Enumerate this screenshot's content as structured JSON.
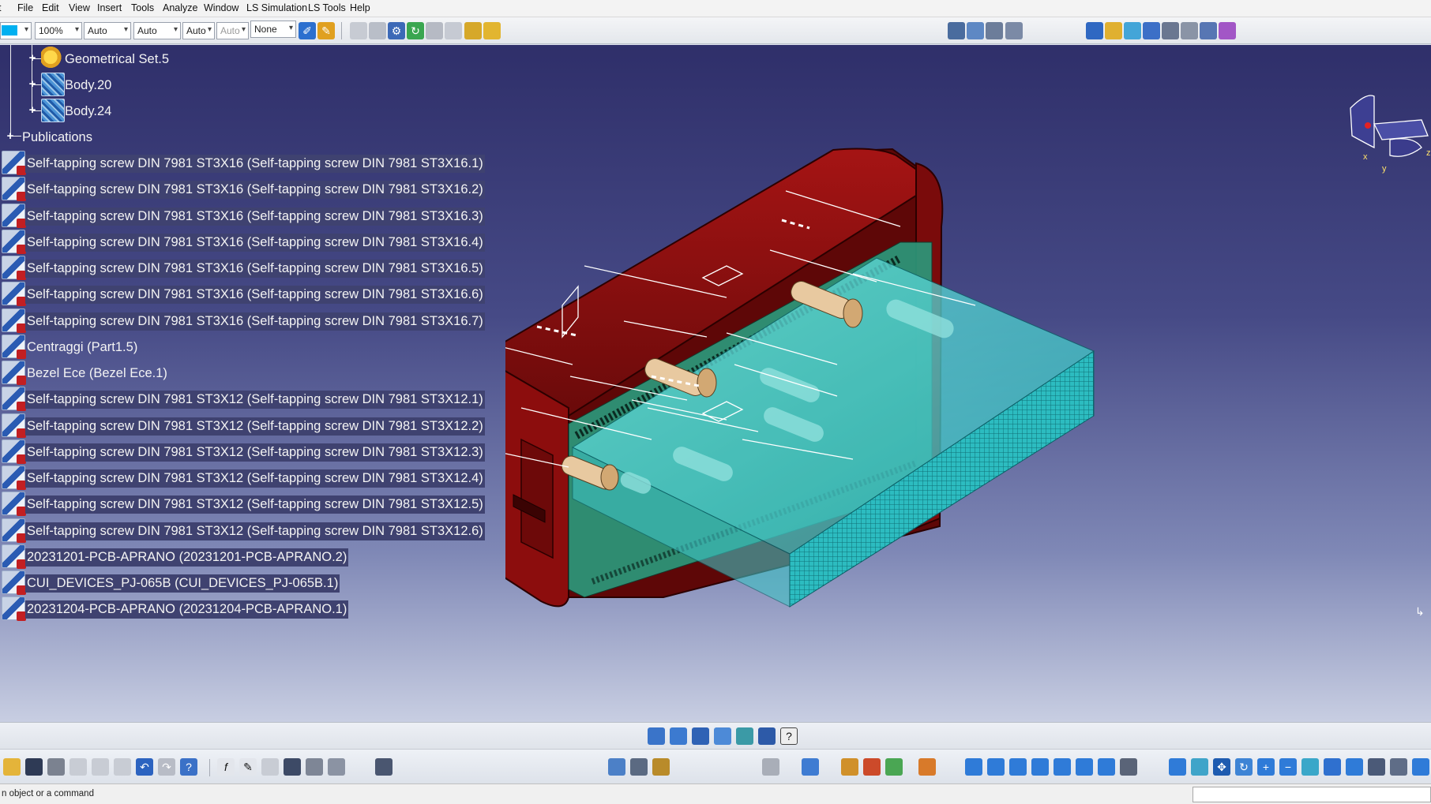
{
  "menu": {
    "items": [
      {
        "label": "File",
        "key": "F"
      },
      {
        "label": "Edit",
        "key": "E"
      },
      {
        "label": "View",
        "key": "V"
      },
      {
        "label": "Insert",
        "key": "I"
      },
      {
        "label": "Tools",
        "key": "T"
      },
      {
        "label": "Analyze",
        "key": "A"
      },
      {
        "label": "Window",
        "key": "W"
      },
      {
        "label": "LS Simulation",
        "key": ""
      },
      {
        "label": "LS Tools",
        "key": ""
      },
      {
        "label": "Help",
        "key": "H"
      }
    ]
  },
  "toolbar": {
    "zoom_value": "100%",
    "combo_auto_1": "Auto",
    "combo_auto_2": "Auto",
    "combo_auto_3": "Auto",
    "combo_auto_4": "Auto",
    "combo_none": "None"
  },
  "tree": {
    "nodes": [
      {
        "label": "Geometrical Set.5",
        "icon": "geometrical-set-icon"
      },
      {
        "label": "Body.20",
        "icon": "body-icon"
      },
      {
        "label": "Body.24",
        "icon": "body-icon"
      },
      {
        "label": "Publications",
        "icon": "publications-icon"
      }
    ],
    "parts": [
      {
        "label": "Self-tapping screw DIN 7981 ST3X16 (Self-tapping screw DIN 7981 ST3X16.1)",
        "selected": true
      },
      {
        "label": "Self-tapping screw DIN 7981 ST3X16 (Self-tapping screw DIN 7981 ST3X16.2)",
        "selected": true
      },
      {
        "label": "Self-tapping screw DIN 7981 ST3X16 (Self-tapping screw DIN 7981 ST3X16.3)",
        "selected": true
      },
      {
        "label": "Self-tapping screw DIN 7981 ST3X16 (Self-tapping screw DIN 7981 ST3X16.4)",
        "selected": true
      },
      {
        "label": "Self-tapping screw DIN 7981 ST3X16 (Self-tapping screw DIN 7981 ST3X16.5)",
        "selected": true
      },
      {
        "label": "Self-tapping screw DIN 7981 ST3X16 (Self-tapping screw DIN 7981 ST3X16.6)",
        "selected": true
      },
      {
        "label": "Self-tapping screw DIN 7981 ST3X16 (Self-tapping screw DIN 7981 ST3X16.7)",
        "selected": true
      },
      {
        "label": "Centraggi (Part1.5)",
        "selected": false
      },
      {
        "label": "Bezel Ece (Bezel Ece.1)",
        "selected": false
      },
      {
        "label": "Self-tapping screw DIN 7981 ST3X12 (Self-tapping screw DIN 7981 ST3X12.1)",
        "selected": true
      },
      {
        "label": "Self-tapping screw DIN 7981 ST3X12 (Self-tapping screw DIN 7981 ST3X12.2)",
        "selected": true
      },
      {
        "label": "Self-tapping screw DIN 7981 ST3X12 (Self-tapping screw DIN 7981 ST3X12.3)",
        "selected": true
      },
      {
        "label": "Self-tapping screw DIN 7981 ST3X12 (Self-tapping screw DIN 7981 ST3X12.4)",
        "selected": true
      },
      {
        "label": "Self-tapping screw DIN 7981 ST3X12 (Self-tapping screw DIN 7981 ST3X12.5)",
        "selected": true
      },
      {
        "label": "Self-tapping screw DIN 7981 ST3X12 (Self-tapping screw DIN 7981 ST3X12.6)",
        "selected": true
      },
      {
        "label": "20231201-PCB-APRANO (20231201-PCB-APRANO.2)",
        "selected": true
      },
      {
        "label": "CUI_DEVICES_PJ-065B (CUI_DEVICES_PJ-065B.1)",
        "selected": true
      },
      {
        "label": "20231204-PCB-APRANO (20231204-PCB-APRANO.1)",
        "selected": true
      }
    ]
  },
  "compass": {
    "axis_x": "x",
    "axis_y": "y",
    "axis_z": "z"
  },
  "model_colors": {
    "housing": "#8c0d0d",
    "pcb": "#4fd6d6",
    "standoff": "#e8c9a0"
  },
  "status": {
    "prompt": "n object or a command",
    "command_value": ""
  }
}
